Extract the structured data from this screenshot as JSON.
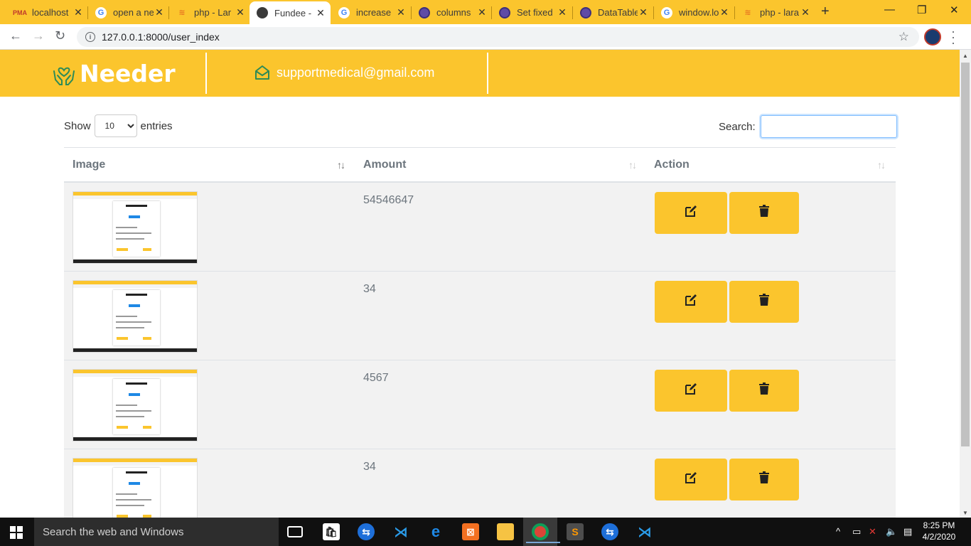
{
  "browser": {
    "tabs": [
      {
        "label": "localhost",
        "favicon": "phpmyadmin-icon",
        "active": false
      },
      {
        "label": "open a ne",
        "favicon": "google-icon",
        "active": false
      },
      {
        "label": "php - Lar",
        "favicon": "stackoverflow-icon",
        "active": false
      },
      {
        "label": "Fundee -",
        "favicon": "web-icon",
        "active": true
      },
      {
        "label": "increase",
        "favicon": "google-icon",
        "active": false
      },
      {
        "label": "columns",
        "favicon": "globe-icon",
        "active": false
      },
      {
        "label": "Set fixed",
        "favicon": "globe-icon",
        "active": false
      },
      {
        "label": "DataTable",
        "favicon": "globe-icon",
        "active": false
      },
      {
        "label": "window.lo",
        "favicon": "google-icon",
        "active": false
      },
      {
        "label": "php - lara",
        "favicon": "stackoverflow-icon",
        "active": false
      }
    ],
    "url": "127.0.0.1:8000/user_index"
  },
  "site": {
    "brand": "Needer",
    "email": "supportmedical@gmail.com",
    "accent_color": "#fbc52d"
  },
  "datatable": {
    "show_label": "Show",
    "entries_value": "10",
    "entries_label": "entries",
    "search_label": "Search:",
    "search_value": "",
    "columns": [
      "Image",
      "Amount",
      "Action"
    ],
    "rows": [
      {
        "amount": "54546647"
      },
      {
        "amount": "34"
      },
      {
        "amount": "4567"
      },
      {
        "amount": "34"
      }
    ]
  },
  "taskbar": {
    "search_placeholder": "Search the web and Windows",
    "time": "8:25 PM",
    "date": "4/2/2020"
  }
}
